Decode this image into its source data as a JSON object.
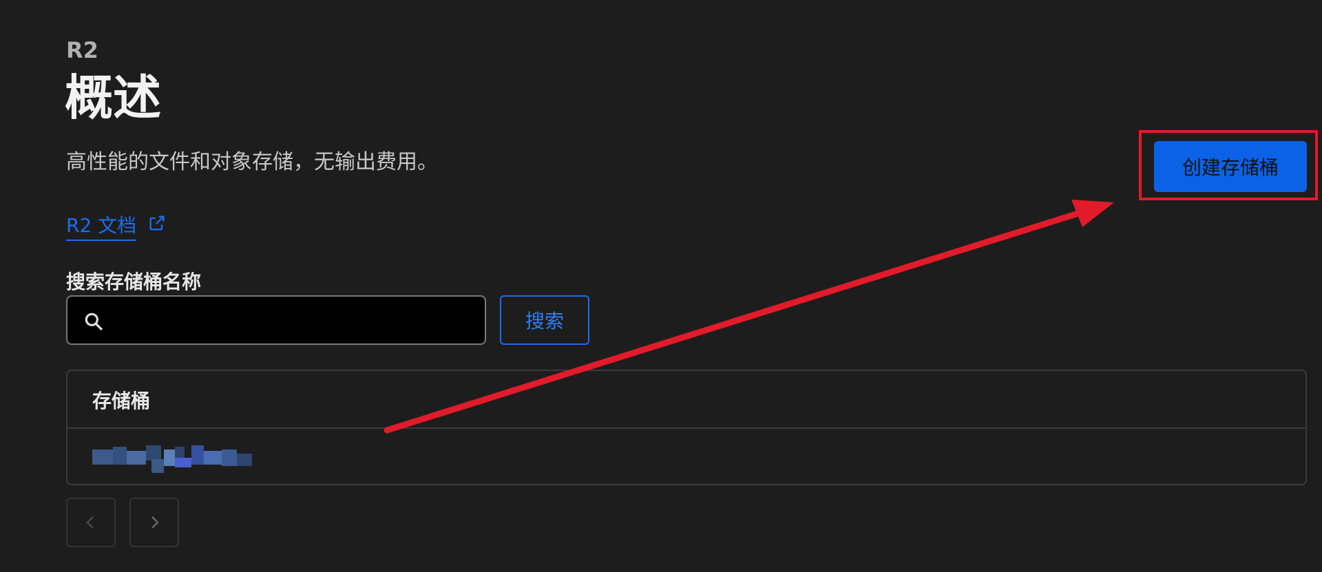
{
  "header": {
    "eyebrow": "R2",
    "title": "概述",
    "subtitle": "高性能的文件和对象存储，无输出费用。"
  },
  "docs": {
    "label": "R2 文档",
    "icon": "external-link-icon"
  },
  "search": {
    "label": "搜索存储桶名称",
    "value": "",
    "placeholder": "",
    "button_label": "搜索",
    "icon": "search-icon"
  },
  "actions": {
    "create_bucket_label": "创建存储桶"
  },
  "table": {
    "header": "存储桶",
    "rows": [
      {
        "name": ""
      }
    ]
  },
  "pagination": {
    "prev_icon": "chevron-left-icon",
    "next_icon": "chevron-right-icon"
  },
  "annotation": {
    "arrow_color": "#e21b2a",
    "highlight_color": "#e21b2a"
  },
  "colors": {
    "background": "#1d1d1d",
    "accent": "#0b62e6",
    "link": "#1d6cf0"
  }
}
